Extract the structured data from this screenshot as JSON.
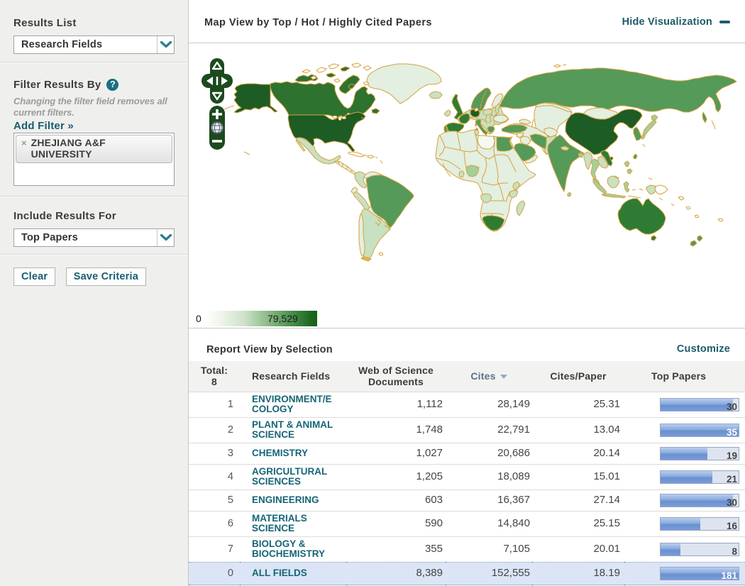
{
  "accent_teal": "#175e71",
  "sidebar": {
    "results_list_label": "Results List",
    "results_list_value": "Research Fields",
    "filter_heading": "Filter Results By",
    "help_icon": "?",
    "filter_note": "Changing the filter field removes all current filters.",
    "add_filter_label": "Add Filter »",
    "filter_chip": {
      "remove_icon": "×",
      "label": "ZHEJIANG A&F UNIVERSITY"
    },
    "include_heading": "Include Results For",
    "include_value": "Top Papers",
    "clear_label": "Clear",
    "save_label": "Save Criteria"
  },
  "map_section": {
    "title": "Map View by Top / Hot / Highly Cited Papers",
    "hide_label": "Hide Visualization",
    "legend_min": "0",
    "legend_max": "79,529"
  },
  "report": {
    "title": "Report View by Selection",
    "customize_label": "Customize",
    "header": {
      "total_label": "Total:",
      "total_value": "8",
      "field": "Research Fields",
      "docs": "Web of Science Documents",
      "cites": "Cites",
      "cites_per_paper": "Cites/Paper",
      "top_papers": "Top Papers"
    },
    "rows": [
      {
        "rank": "1",
        "field": "ENVIRONMENT/ECOLOGY",
        "docs": "1,112",
        "cites": "28,149",
        "cpp": "25.31",
        "top": "30",
        "pct": 93,
        "white": false,
        "hl": false
      },
      {
        "rank": "2",
        "field": "PLANT & ANIMAL SCIENCE",
        "docs": "1,748",
        "cites": "22,791",
        "cpp": "13.04",
        "top": "35",
        "pct": 100,
        "white": true,
        "hl": false
      },
      {
        "rank": "3",
        "field": "CHEMISTRY",
        "docs": "1,027",
        "cites": "20,686",
        "cpp": "20.14",
        "top": "19",
        "pct": 60,
        "white": false,
        "hl": false
      },
      {
        "rank": "4",
        "field": "AGRICULTURAL SCIENCES",
        "docs": "1,205",
        "cites": "18,089",
        "cpp": "15.01",
        "top": "21",
        "pct": 66,
        "white": false,
        "hl": false
      },
      {
        "rank": "5",
        "field": "ENGINEERING",
        "docs": "603",
        "cites": "16,367",
        "cpp": "27.14",
        "top": "30",
        "pct": 93,
        "white": false,
        "hl": false
      },
      {
        "rank": "6",
        "field": "MATERIALS SCIENCE",
        "docs": "590",
        "cites": "14,840",
        "cpp": "25.15",
        "top": "16",
        "pct": 51,
        "white": false,
        "hl": false
      },
      {
        "rank": "7",
        "field": "BIOLOGY & BIOCHEMISTRY",
        "docs": "355",
        "cites": "7,105",
        "cpp": "20.01",
        "top": "8",
        "pct": 25,
        "white": false,
        "hl": false
      },
      {
        "rank": "0",
        "field": "ALL FIELDS",
        "docs": "8,389",
        "cites": "152,555",
        "cpp": "18.19",
        "top": "181",
        "pct": 100,
        "white": true,
        "hl": true
      }
    ]
  },
  "map_colors": {
    "border": "#d6a13c",
    "none": "#ffffff",
    "vlow": "#e3efe0",
    "low": "#c8e1c2",
    "mlow": "#a4cf9b",
    "mid": "#559a58",
    "high": "#2e7c33",
    "top": "#1d5c24",
    "canada": "#2d722f"
  }
}
